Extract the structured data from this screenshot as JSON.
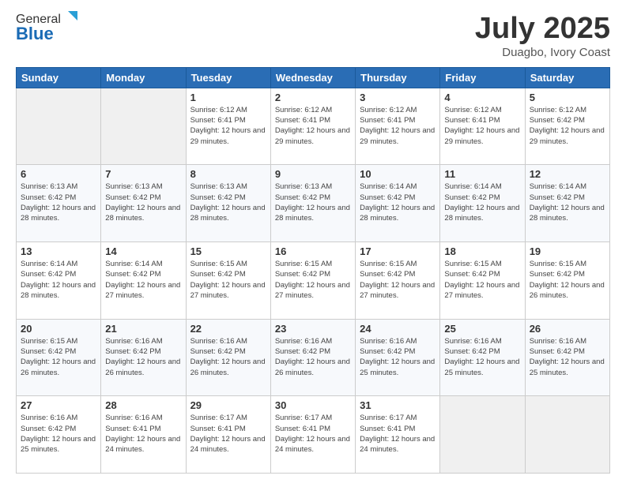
{
  "header": {
    "logo_general": "General",
    "logo_blue": "Blue",
    "title": "July 2025",
    "location": "Duagbo, Ivory Coast"
  },
  "calendar": {
    "days_of_week": [
      "Sunday",
      "Monday",
      "Tuesday",
      "Wednesday",
      "Thursday",
      "Friday",
      "Saturday"
    ],
    "weeks": [
      [
        {
          "day": "",
          "info": ""
        },
        {
          "day": "",
          "info": ""
        },
        {
          "day": "1",
          "info": "Sunrise: 6:12 AM\nSunset: 6:41 PM\nDaylight: 12 hours and 29 minutes."
        },
        {
          "day": "2",
          "info": "Sunrise: 6:12 AM\nSunset: 6:41 PM\nDaylight: 12 hours and 29 minutes."
        },
        {
          "day": "3",
          "info": "Sunrise: 6:12 AM\nSunset: 6:41 PM\nDaylight: 12 hours and 29 minutes."
        },
        {
          "day": "4",
          "info": "Sunrise: 6:12 AM\nSunset: 6:41 PM\nDaylight: 12 hours and 29 minutes."
        },
        {
          "day": "5",
          "info": "Sunrise: 6:12 AM\nSunset: 6:42 PM\nDaylight: 12 hours and 29 minutes."
        }
      ],
      [
        {
          "day": "6",
          "info": "Sunrise: 6:13 AM\nSunset: 6:42 PM\nDaylight: 12 hours and 28 minutes."
        },
        {
          "day": "7",
          "info": "Sunrise: 6:13 AM\nSunset: 6:42 PM\nDaylight: 12 hours and 28 minutes."
        },
        {
          "day": "8",
          "info": "Sunrise: 6:13 AM\nSunset: 6:42 PM\nDaylight: 12 hours and 28 minutes."
        },
        {
          "day": "9",
          "info": "Sunrise: 6:13 AM\nSunset: 6:42 PM\nDaylight: 12 hours and 28 minutes."
        },
        {
          "day": "10",
          "info": "Sunrise: 6:14 AM\nSunset: 6:42 PM\nDaylight: 12 hours and 28 minutes."
        },
        {
          "day": "11",
          "info": "Sunrise: 6:14 AM\nSunset: 6:42 PM\nDaylight: 12 hours and 28 minutes."
        },
        {
          "day": "12",
          "info": "Sunrise: 6:14 AM\nSunset: 6:42 PM\nDaylight: 12 hours and 28 minutes."
        }
      ],
      [
        {
          "day": "13",
          "info": "Sunrise: 6:14 AM\nSunset: 6:42 PM\nDaylight: 12 hours and 28 minutes."
        },
        {
          "day": "14",
          "info": "Sunrise: 6:14 AM\nSunset: 6:42 PM\nDaylight: 12 hours and 27 minutes."
        },
        {
          "day": "15",
          "info": "Sunrise: 6:15 AM\nSunset: 6:42 PM\nDaylight: 12 hours and 27 minutes."
        },
        {
          "day": "16",
          "info": "Sunrise: 6:15 AM\nSunset: 6:42 PM\nDaylight: 12 hours and 27 minutes."
        },
        {
          "day": "17",
          "info": "Sunrise: 6:15 AM\nSunset: 6:42 PM\nDaylight: 12 hours and 27 minutes."
        },
        {
          "day": "18",
          "info": "Sunrise: 6:15 AM\nSunset: 6:42 PM\nDaylight: 12 hours and 27 minutes."
        },
        {
          "day": "19",
          "info": "Sunrise: 6:15 AM\nSunset: 6:42 PM\nDaylight: 12 hours and 26 minutes."
        }
      ],
      [
        {
          "day": "20",
          "info": "Sunrise: 6:15 AM\nSunset: 6:42 PM\nDaylight: 12 hours and 26 minutes."
        },
        {
          "day": "21",
          "info": "Sunrise: 6:16 AM\nSunset: 6:42 PM\nDaylight: 12 hours and 26 minutes."
        },
        {
          "day": "22",
          "info": "Sunrise: 6:16 AM\nSunset: 6:42 PM\nDaylight: 12 hours and 26 minutes."
        },
        {
          "day": "23",
          "info": "Sunrise: 6:16 AM\nSunset: 6:42 PM\nDaylight: 12 hours and 26 minutes."
        },
        {
          "day": "24",
          "info": "Sunrise: 6:16 AM\nSunset: 6:42 PM\nDaylight: 12 hours and 25 minutes."
        },
        {
          "day": "25",
          "info": "Sunrise: 6:16 AM\nSunset: 6:42 PM\nDaylight: 12 hours and 25 minutes."
        },
        {
          "day": "26",
          "info": "Sunrise: 6:16 AM\nSunset: 6:42 PM\nDaylight: 12 hours and 25 minutes."
        }
      ],
      [
        {
          "day": "27",
          "info": "Sunrise: 6:16 AM\nSunset: 6:42 PM\nDaylight: 12 hours and 25 minutes."
        },
        {
          "day": "28",
          "info": "Sunrise: 6:16 AM\nSunset: 6:41 PM\nDaylight: 12 hours and 24 minutes."
        },
        {
          "day": "29",
          "info": "Sunrise: 6:17 AM\nSunset: 6:41 PM\nDaylight: 12 hours and 24 minutes."
        },
        {
          "day": "30",
          "info": "Sunrise: 6:17 AM\nSunset: 6:41 PM\nDaylight: 12 hours and 24 minutes."
        },
        {
          "day": "31",
          "info": "Sunrise: 6:17 AM\nSunset: 6:41 PM\nDaylight: 12 hours and 24 minutes."
        },
        {
          "day": "",
          "info": ""
        },
        {
          "day": "",
          "info": ""
        }
      ]
    ]
  }
}
